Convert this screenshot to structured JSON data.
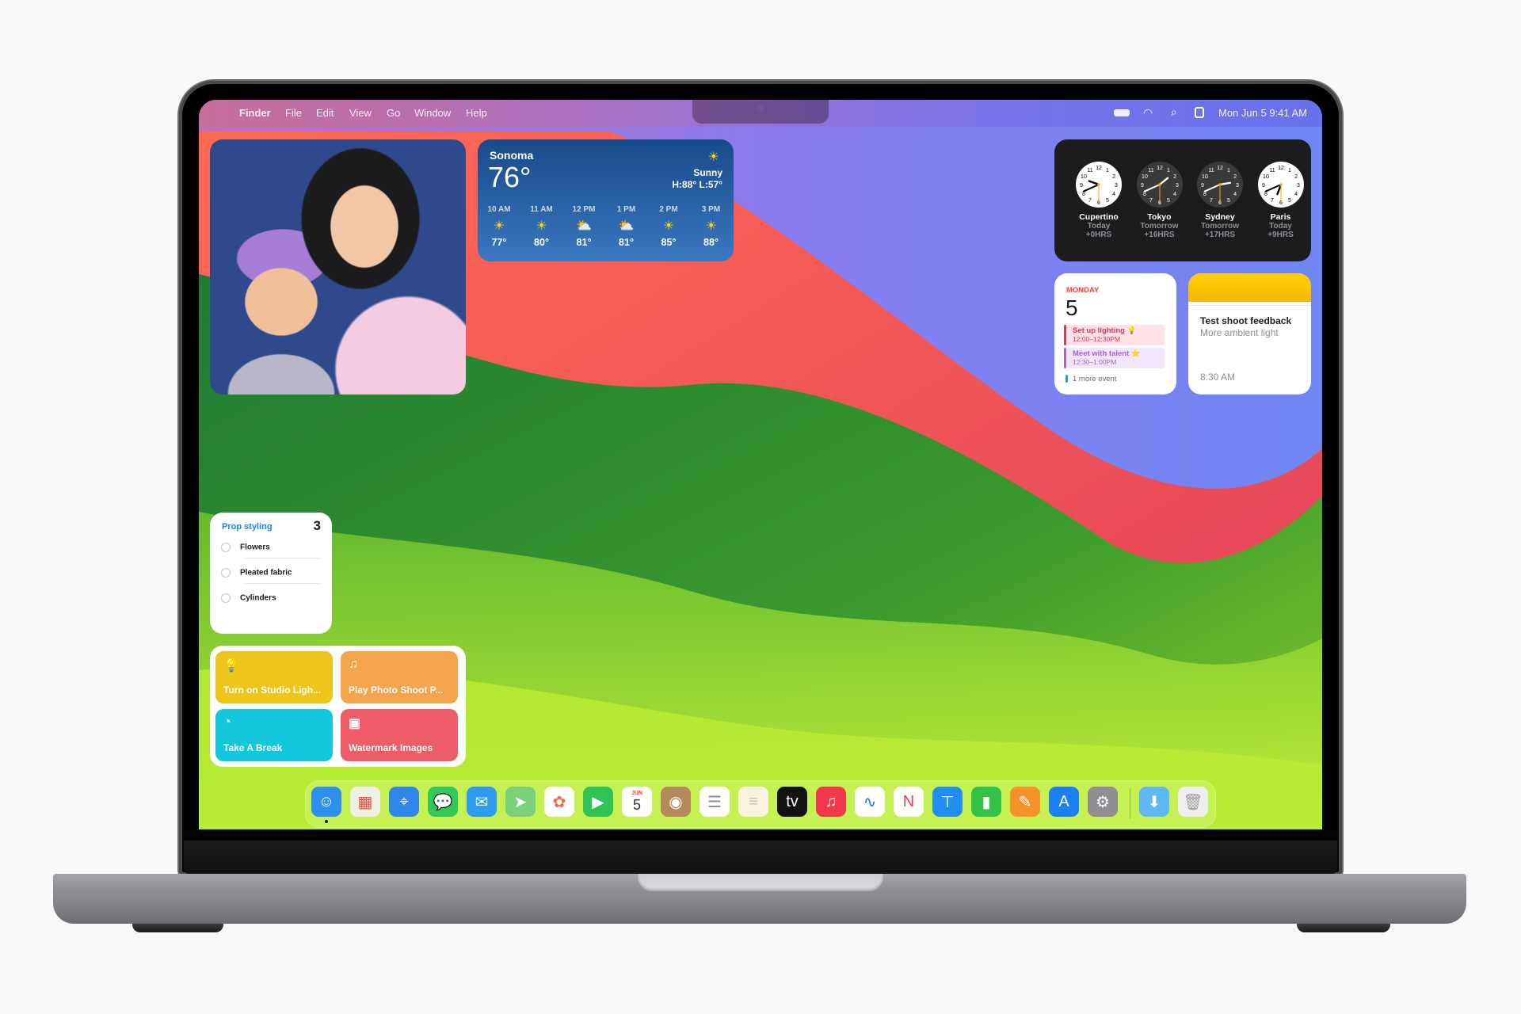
{
  "menubar": {
    "apple_icon": "apple-icon",
    "items": [
      {
        "label": "Finder",
        "active": true
      },
      {
        "label": "File"
      },
      {
        "label": "Edit"
      },
      {
        "label": "View"
      },
      {
        "label": "Go"
      },
      {
        "label": "Window"
      },
      {
        "label": "Help"
      }
    ],
    "status": {
      "icons": [
        "battery-icon",
        "wifi-icon",
        "search-icon",
        "control-center-icon"
      ],
      "datetime": "Mon Jun 5  9:41 AM"
    }
  },
  "widgets": {
    "photo": {
      "description": "Selfie of a smiling woman and child against a blue wall"
    },
    "weather": {
      "location": "Sonoma",
      "temperature": "76°",
      "condition": "Sunny",
      "high_low": "H:88° L:57°",
      "condition_icon": "sun-icon",
      "hourly": [
        {
          "time": "10 AM",
          "icon": "sun-icon",
          "temp": "77°"
        },
        {
          "time": "11 AM",
          "icon": "sun-icon",
          "temp": "80°"
        },
        {
          "time": "12 PM",
          "icon": "partly-cloudy-icon",
          "temp": "81°"
        },
        {
          "time": "1 PM",
          "icon": "partly-cloudy-icon",
          "temp": "81°"
        },
        {
          "time": "2 PM",
          "icon": "sun-icon",
          "temp": "85°"
        },
        {
          "time": "3 PM",
          "icon": "sun-icon",
          "temp": "88°"
        }
      ]
    },
    "world_clock": {
      "clocks": [
        {
          "city": "Cupertino",
          "day": "Today",
          "offset": "+0HRS",
          "theme": "light",
          "time": "9:41"
        },
        {
          "city": "Tokyo",
          "day": "Tomorrow",
          "offset": "+16HRS",
          "theme": "dark",
          "time": "1:41"
        },
        {
          "city": "Sydney",
          "day": "Tomorrow",
          "offset": "+17HRS",
          "theme": "dark",
          "time": "2:41"
        },
        {
          "city": "Paris",
          "day": "Today",
          "offset": "+9HRS",
          "theme": "light",
          "time": "6:41"
        }
      ]
    },
    "calendar": {
      "weekday": "MONDAY",
      "day": "5",
      "events": [
        {
          "title": "Set up lighting 💡",
          "time": "12:00–12:30PM",
          "color": "#e8335a",
          "bg": "#fde3e8"
        },
        {
          "title": "Meet with talent ⭐",
          "time": "12:30–1:00PM",
          "color": "#a95fd6",
          "bg": "#f2e6fb"
        }
      ],
      "more": "1 more event",
      "more_color": "#1aa1f0"
    },
    "notes": {
      "title": "Test shoot feedback",
      "body": "More ambient light",
      "time": "8:30 AM"
    },
    "reminders": {
      "list_name": "Prop styling",
      "count": "3",
      "items": [
        "Flowers",
        "Pleated fabric",
        "Cylinders"
      ]
    },
    "shortcuts": {
      "tiles": [
        {
          "label": "Turn on Studio Ligh...",
          "icon": "lightbulb-icon",
          "glyph": "💡",
          "color": "#eec51a"
        },
        {
          "label": "Play Photo Shoot P...",
          "icon": "music-note-icon",
          "glyph": "♫",
          "color": "#f4a44a"
        },
        {
          "label": "Take A Break",
          "icon": "timer-icon",
          "glyph": "◔",
          "color": "#13c7dd"
        },
        {
          "label": "Watermark Images",
          "icon": "image-icon",
          "glyph": "▣",
          "color": "#ee5c68"
        }
      ]
    }
  },
  "dock": {
    "apps": [
      {
        "name": "Finder",
        "icon": "finder-icon",
        "glyph": "☺",
        "bg": "#2d8ff0",
        "running": true
      },
      {
        "name": "Launchpad",
        "icon": "launchpad-icon",
        "glyph": "▦",
        "bg": "#efefe6",
        "fg": "#e74c3c"
      },
      {
        "name": "Safari",
        "icon": "safari-icon",
        "glyph": "⌖",
        "bg": "#2f86e8"
      },
      {
        "name": "Messages",
        "icon": "messages-icon",
        "glyph": "💬",
        "bg": "#33c759"
      },
      {
        "name": "Mail",
        "icon": "mail-icon",
        "glyph": "✉",
        "bg": "#2d9cf0"
      },
      {
        "name": "Maps",
        "icon": "maps-icon",
        "glyph": "➤",
        "bg": "#7bd07a"
      },
      {
        "name": "Photos",
        "icon": "photos-icon",
        "glyph": "✿",
        "bg": "#ffffff",
        "fg": "#f06a4a"
      },
      {
        "name": "FaceTime",
        "icon": "facetime-icon",
        "glyph": "▶",
        "bg": "#2fc355"
      },
      {
        "name": "Calendar",
        "icon": "calendar-icon",
        "glyph": "5",
        "bg": "#ffffff",
        "fg": "#333333",
        "label_top": "JUN"
      },
      {
        "name": "Contacts",
        "icon": "contacts-icon",
        "glyph": "◉",
        "bg": "#b58a5a"
      },
      {
        "name": "Reminders",
        "icon": "reminders-icon",
        "glyph": "☰",
        "bg": "#ffffff",
        "fg": "#8e8e93"
      },
      {
        "name": "Notes",
        "icon": "notes-icon",
        "glyph": "≡",
        "bg": "#f7f3df",
        "fg": "#c9c3a5"
      },
      {
        "name": "TV",
        "icon": "apple-tv-icon",
        "glyph": "tv",
        "bg": "#111111"
      },
      {
        "name": "Music",
        "icon": "music-icon",
        "glyph": "♫",
        "bg": "#f2384d"
      },
      {
        "name": "Freeform",
        "icon": "freeform-icon",
        "glyph": "∿",
        "bg": "#ffffff",
        "fg": "#1a6fd6"
      },
      {
        "name": "News",
        "icon": "news-icon",
        "glyph": "N",
        "bg": "#ffffff",
        "fg": "#f0394f"
      },
      {
        "name": "Keynote",
        "icon": "keynote-icon",
        "glyph": "⊤",
        "bg": "#1f8ef0"
      },
      {
        "name": "Numbers",
        "icon": "numbers-icon",
        "glyph": "▮",
        "bg": "#33c247"
      },
      {
        "name": "Pages",
        "icon": "pages-icon",
        "glyph": "✎",
        "bg": "#f6922a"
      },
      {
        "name": "App Store",
        "icon": "app-store-icon",
        "glyph": "A",
        "bg": "#1a7ff0"
      },
      {
        "name": "System Settings",
        "icon": "settings-icon",
        "glyph": "⚙",
        "bg": "#8e8e93"
      },
      {
        "name": "Downloads",
        "icon": "downloads-folder-icon",
        "glyph": "⬇",
        "bg": "#5fb8f2"
      },
      {
        "name": "Trash",
        "icon": "trash-icon",
        "glyph": "🗑",
        "bg": "#eeeeee",
        "fg": "#a0a0a0"
      }
    ]
  }
}
